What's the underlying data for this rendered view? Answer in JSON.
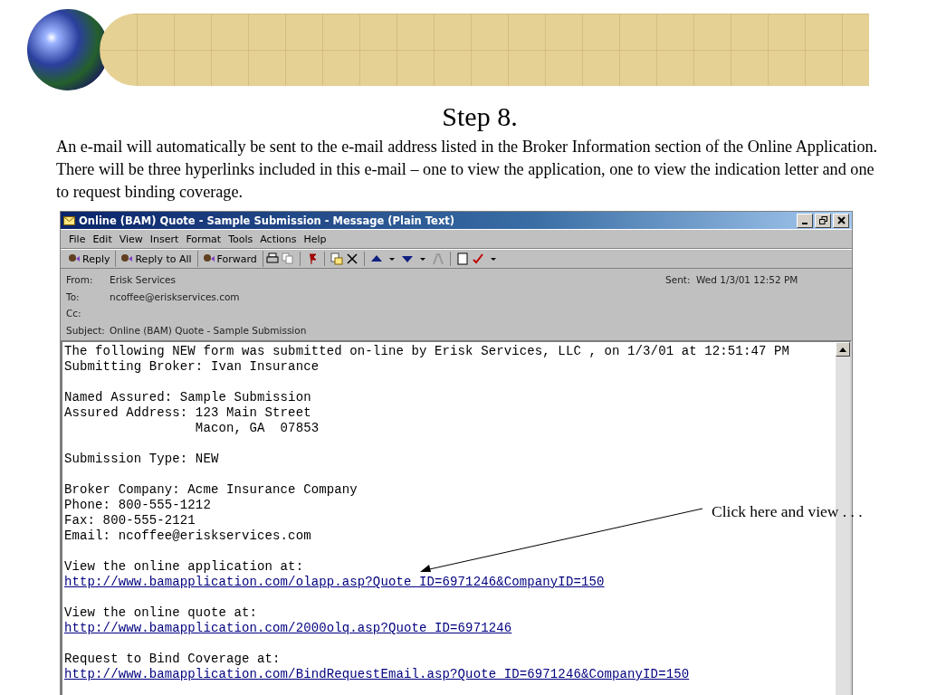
{
  "slide": {
    "title": "Step 8.",
    "paragraph": "An e-mail will automatically be sent to the e-mail address listed in the Broker Information section of the Online Application.  There will be three hyperlinks included in this e-mail – one to view the application, one to view the indication letter and one to request binding coverage."
  },
  "window": {
    "title": "Online (BAM) Quote - Sample Submission - Message (Plain Text)",
    "menu": [
      "File",
      "Edit",
      "View",
      "Insert",
      "Format",
      "Tools",
      "Actions",
      "Help"
    ],
    "toolbar": [
      "Reply",
      "Reply to All",
      "Forward"
    ],
    "header": [
      {
        "label": "From:",
        "value": "Erisk Services"
      },
      {
        "label": "To:",
        "value": "ncoffee@eriskservices.com"
      },
      {
        "label": "Cc:"
      },
      {
        "label": "Subject:",
        "value": "Online (BAM) Quote - Sample Submission"
      }
    ],
    "sent": {
      "label": "Sent:",
      "value": "Wed 1/3/01 12:52 PM"
    },
    "body": [
      [
        {
          "kind": "text",
          "text": "The following NEW form was submitted on-line by Erisk Services, LLC , on 1/3/01 at 12:51:47 PM"
        },
        {
          "kind": "text",
          "text": "Submitting Broker: Ivan Insurance"
        }
      ],
      [
        {
          "kind": "text",
          "text": "Named Assured: Sample Submission"
        },
        {
          "kind": "text",
          "text": "Assured Address: 123 Main Street"
        },
        {
          "kind": "text",
          "text": "                 Macon, GA  07853"
        }
      ],
      [
        {
          "kind": "text",
          "text": "Submission Type: NEW"
        }
      ],
      [
        {
          "kind": "text",
          "text": "Broker Company: Acme Insurance Company"
        },
        {
          "kind": "text",
          "text": "Phone: 800-555-1212"
        },
        {
          "kind": "text",
          "text": "Fax: 800-555-2121"
        },
        {
          "kind": "text",
          "text": "Email: ncoffee@eriskservices.com"
        }
      ],
      [
        {
          "kind": "text",
          "text": "View the online application at:"
        },
        {
          "kind": "link",
          "text": "http://www.bamapplication.com/olapp.asp?Quote_ID=6971246&CompanyID=150"
        }
      ],
      [
        {
          "kind": "text",
          "text": "View the online quote at:"
        },
        {
          "kind": "link",
          "text": "http://www.bamapplication.com/2000olq.asp?Quote_ID=6971246"
        }
      ],
      [
        {
          "kind": "text",
          "text": "Request to Bind Coverage at:"
        },
        {
          "kind": "link",
          "text": "http://www.bamapplication.com/BindRequestEmail.asp?Quote_ID=6971246&CompanyID=150"
        }
      ]
    ]
  },
  "callout": "Click here and view . . ."
}
